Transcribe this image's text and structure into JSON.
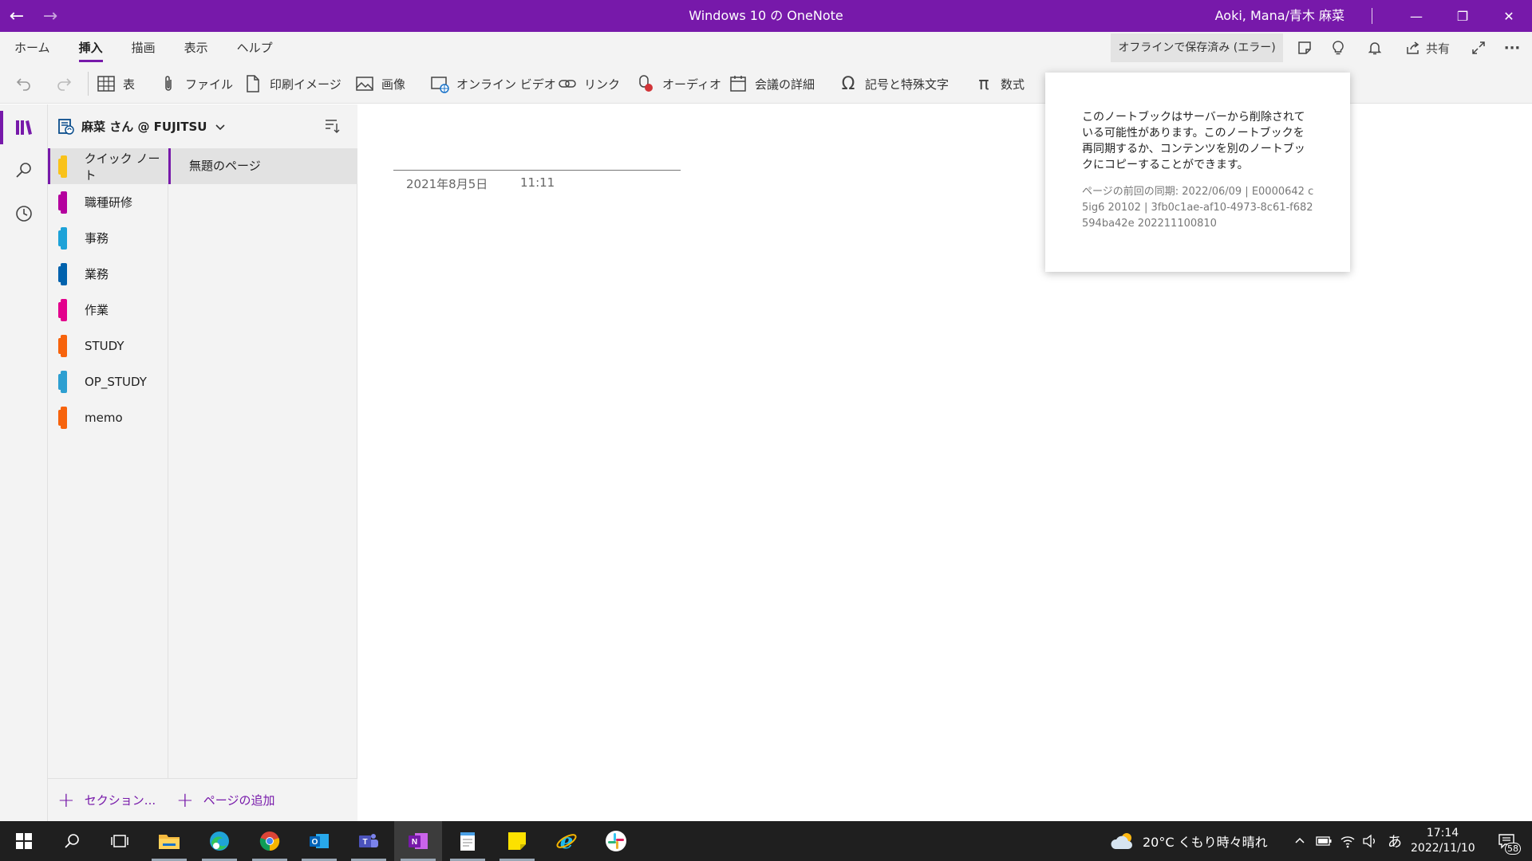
{
  "window": {
    "title": "Windows 10 の OneNote",
    "user": "Aoki, Mana/青木 麻菜",
    "back_icon": "←",
    "forward_icon": "→",
    "minimize_icon": "—",
    "restore_icon": "❐",
    "close_icon": "✕"
  },
  "ribbon": {
    "tabs": [
      "ホーム",
      "挿入",
      "描画",
      "表示",
      "ヘルプ"
    ],
    "active_tab": "挿入",
    "status": "オフラインで保存済み (エラー)",
    "share_label": "共有",
    "more": "···"
  },
  "toolbar": {
    "table": "表",
    "file": "ファイル",
    "printout": "印刷イメージ",
    "picture": "画像",
    "online_video": "オンライン ビデオ",
    "link": "リンク",
    "audio": "オーディオ",
    "meeting": "会議の詳細",
    "symbol": "記号と特殊文字",
    "equation": "数式"
  },
  "notebook": {
    "name": "麻菜 さん @ FUJITSU"
  },
  "sections": [
    {
      "label": "クイック ノート",
      "color": "#F9C21A"
    },
    {
      "label": "職種研修",
      "color": "#B4009E"
    },
    {
      "label": "事務",
      "color": "#1DA2D8"
    },
    {
      "label": "業務",
      "color": "#0062AD"
    },
    {
      "label": "作業",
      "color": "#E3008C"
    },
    {
      "label": "STUDY",
      "color": "#F7630C"
    },
    {
      "label": "OP_STUDY",
      "color": "#2D9FD1"
    },
    {
      "label": "memo",
      "color": "#F7630C"
    }
  ],
  "pages": [
    {
      "label": "無題のページ"
    }
  ],
  "footer": {
    "add_section": "セクション...",
    "add_page": "ページの追加"
  },
  "page": {
    "date": "2021年8月5日",
    "time": "11:11"
  },
  "popup": {
    "message": "このノートブックはサーバーから削除されている可能性があります。このノートブックを再同期するか、コンテンツを別のノートブックにコピーすることができます。",
    "detail": "ページの前回の同期: 2022/06/09 | E0000642 c5ig6 20102 | 3fb0c1ae-af10-4973-8c61-f682594ba42e 202211100810"
  },
  "taskbar": {
    "weather": "20°C くもり時々晴れ",
    "time": "17:14",
    "date": "2022/11/10",
    "ime": "あ",
    "notifications": "58"
  },
  "colors": {
    "accent": "#7719AA"
  }
}
